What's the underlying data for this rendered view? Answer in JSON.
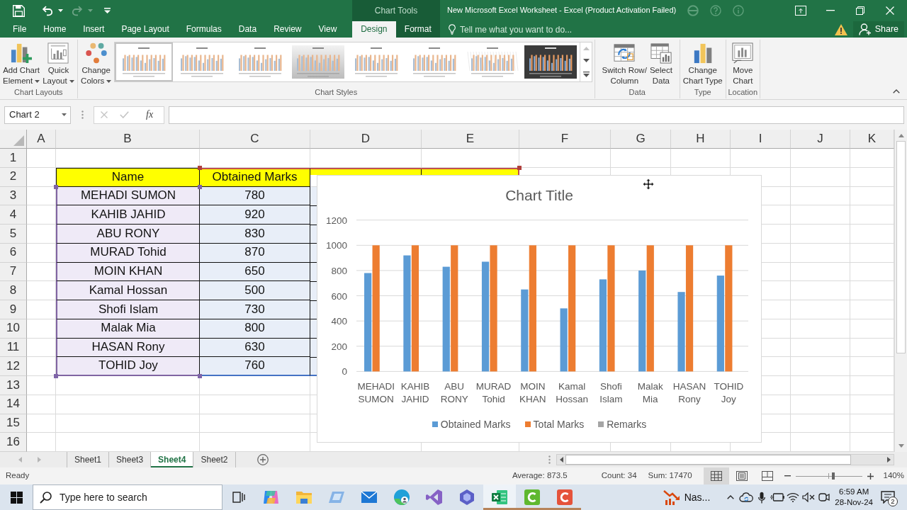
{
  "window": {
    "title": "New Microsoft Excel Worksheet - Excel (Product Activation Failed)",
    "context_label": "Chart Tools"
  },
  "quick_access": {
    "undo": {
      "disabled": false
    },
    "redo": {
      "disabled": true
    }
  },
  "tabs": [
    {
      "label": "File",
      "selected": false,
      "contextual": false
    },
    {
      "label": "Home",
      "selected": false,
      "contextual": false
    },
    {
      "label": "Insert",
      "selected": false,
      "contextual": false
    },
    {
      "label": "Page Layout",
      "selected": false,
      "contextual": false
    },
    {
      "label": "Formulas",
      "selected": false,
      "contextual": false
    },
    {
      "label": "Data",
      "selected": false,
      "contextual": false
    },
    {
      "label": "Review",
      "selected": false,
      "contextual": false
    },
    {
      "label": "View",
      "selected": false,
      "contextual": false
    },
    {
      "label": "Design",
      "selected": true,
      "contextual": true
    },
    {
      "label": "Format",
      "selected": false,
      "contextual": true
    }
  ],
  "tell_me": {
    "placeholder": "Tell me what you want to do..."
  },
  "share": {
    "label": "Share"
  },
  "ribbon": {
    "groups": [
      {
        "label": "Chart Layouts",
        "buttons": [
          {
            "lines": [
              "Add Chart",
              "Element"
            ],
            "menu": true
          },
          {
            "lines": [
              "Quick",
              "Layout"
            ],
            "menu": true
          }
        ]
      },
      {
        "label": "Chart Styles",
        "buttons": [
          {
            "lines": [
              "Change",
              "Colors"
            ],
            "menu": true
          }
        ],
        "gallery": [
          {
            "kind": "light",
            "selected": true
          },
          {
            "kind": "light",
            "selected": false
          },
          {
            "kind": "light",
            "selected": false
          },
          {
            "kind": "shaded",
            "selected": false
          },
          {
            "kind": "light",
            "selected": false
          },
          {
            "kind": "light",
            "selected": false
          },
          {
            "kind": "patterned",
            "selected": false
          },
          {
            "kind": "dark",
            "selected": false
          }
        ]
      },
      {
        "label": "Data",
        "buttons": [
          {
            "lines": [
              "Switch Row/",
              "Column"
            ],
            "menu": false
          },
          {
            "lines": [
              "Select",
              "Data"
            ],
            "menu": false
          }
        ]
      },
      {
        "label": "Type",
        "buttons": [
          {
            "lines": [
              "Change",
              "Chart Type"
            ],
            "menu": false
          }
        ]
      },
      {
        "label": "Location",
        "buttons": [
          {
            "lines": [
              "Move",
              "Chart"
            ],
            "menu": false
          }
        ]
      }
    ]
  },
  "formula_bar": {
    "name_box": "Chart 2",
    "cancel": {
      "disabled": true
    },
    "enter": {
      "disabled": true
    },
    "function_label": "fx"
  },
  "sheet": {
    "columns": [
      "A",
      "B",
      "C",
      "D",
      "E",
      "F",
      "G",
      "H",
      "I",
      "J",
      "K"
    ],
    "rows": [
      "1",
      "2",
      "3",
      "4",
      "5",
      "6",
      "7",
      "8",
      "9",
      "10",
      "11",
      "12",
      "13",
      "14",
      "15",
      "16"
    ],
    "table": {
      "header": [
        "Name",
        "Obtained Marks"
      ],
      "rows": [
        [
          "MEHADI SUMON",
          "780"
        ],
        [
          "KAHIB JAHID",
          "920"
        ],
        [
          "ABU RONY",
          "830"
        ],
        [
          "MURAD Tohid",
          "870"
        ],
        [
          "MOIN KHAN",
          "650"
        ],
        [
          "Kamal Hossan",
          "500"
        ],
        [
          "Shofi Islam",
          "730"
        ],
        [
          "Malak Mia",
          "800"
        ],
        [
          "HASAN Rony",
          "630"
        ],
        [
          "TOHID Joy",
          "760"
        ]
      ]
    }
  },
  "chart": {
    "selected": true,
    "chart_data": {
      "type": "bar",
      "title": "Chart Title",
      "categories": [
        "MEHADI SUMON",
        "KAHIB JAHID",
        "ABU RONY",
        "MURAD Tohid",
        "MOIN KHAN",
        "Kamal Hossan",
        "Shofi Islam",
        "Malak Mia",
        "HASAN Rony",
        "TOHID Joy"
      ],
      "series": [
        {
          "name": "Obtained Marks",
          "color": "#5b9bd5",
          "values": [
            780,
            920,
            830,
            870,
            650,
            500,
            730,
            800,
            630,
            760
          ]
        },
        {
          "name": "Total Marks",
          "color": "#ed7d31",
          "values": [
            1000,
            1000,
            1000,
            1000,
            1000,
            1000,
            1000,
            1000,
            1000,
            1000
          ]
        },
        {
          "name": "Remarks",
          "color": "#a5a5a5",
          "values": [
            null,
            null,
            null,
            null,
            null,
            null,
            null,
            null,
            null,
            null
          ]
        }
      ],
      "ylim": [
        0,
        1200
      ],
      "yticks": [
        0,
        200,
        400,
        600,
        800,
        1000,
        1200
      ],
      "grid": true,
      "legend": "bottom"
    }
  },
  "sheet_tabs": [
    {
      "label": "Sheet1",
      "selected": false
    },
    {
      "label": "Sheet3",
      "selected": false
    },
    {
      "label": "Sheet4",
      "selected": true
    },
    {
      "label": "Sheet2",
      "selected": false
    }
  ],
  "status_bar": {
    "mode": "Ready",
    "average": "Average: 873.5",
    "count": "Count: 34",
    "sum": "Sum: 17470",
    "views": [
      {
        "selected": true
      },
      {
        "selected": false
      },
      {
        "selected": false
      }
    ],
    "zoom": {
      "level": 0.57,
      "label": "140%"
    }
  },
  "taskbar": {
    "search": {
      "placeholder": "Type here to search"
    },
    "apps": [
      {
        "running": false,
        "active": false
      },
      {
        "running": false,
        "active": false
      },
      {
        "running": false,
        "active": false
      },
      {
        "running": false,
        "active": false
      },
      {
        "running": false,
        "active": false
      },
      {
        "running": false,
        "active": false
      },
      {
        "running": false,
        "active": false
      },
      {
        "running": true,
        "active": true
      },
      {
        "running": true,
        "active": false
      },
      {
        "running": true,
        "active": false
      }
    ],
    "widget": {
      "label": "Nas..."
    },
    "clock": {
      "time": "6:59 AM",
      "date": "28-Nov-24"
    },
    "notifications": {
      "count": "2"
    }
  }
}
